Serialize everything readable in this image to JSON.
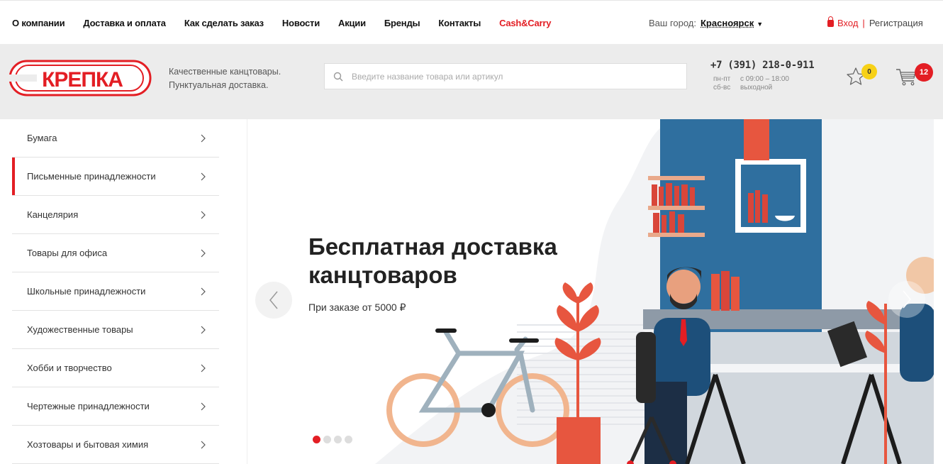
{
  "topnav": {
    "items": [
      "О компании",
      "Доставка и оплата",
      "Как сделать заказ",
      "Новости",
      "Акции",
      "Бренды",
      "Контакты",
      "Cash&Carry"
    ],
    "city_label": "Ваш город:",
    "city_value": "Красноярск",
    "login": "Вход",
    "separator": "|",
    "register": "Регистрация"
  },
  "header": {
    "logo_text": "КРЕПКА",
    "tagline_line1": "Качественные канцтовары.",
    "tagline_line2": "Пунктуальная доставка.",
    "search_placeholder": "Введите название товара или артикул",
    "phone": "+7 (391) 218-0-911",
    "hours": [
      {
        "days": "пн-пт",
        "time": "с 09:00 – 18:00"
      },
      {
        "days": "сб-вс",
        "time": "выходной"
      }
    ],
    "favorites_count": "0",
    "cart_count": "12"
  },
  "sidebar": {
    "items": [
      {
        "label": "Бумага",
        "active": false
      },
      {
        "label": "Письменные принадлежности",
        "active": true
      },
      {
        "label": "Канцелярия",
        "active": false
      },
      {
        "label": "Товары для офиса",
        "active": false
      },
      {
        "label": "Школьные принадлежности",
        "active": false
      },
      {
        "label": "Художественные товары",
        "active": false
      },
      {
        "label": "Хобби и творчество",
        "active": false
      },
      {
        "label": "Чертежные принадлежности",
        "active": false
      },
      {
        "label": "Хозтовары и бытовая химия",
        "active": false
      }
    ]
  },
  "banner": {
    "headline_line1": "Бесплатная доставка",
    "headline_line2": "канцтоваров",
    "subline": "При заказе от 5000 ₽",
    "slides_total": 4,
    "active_slide": 1
  },
  "colors": {
    "brand_red": "#e31e24",
    "badge_yellow": "#f7d117",
    "header_gray": "#ececec",
    "banner_blue": "#2f6f9f"
  },
  "icons": [
    "lock-icon",
    "caret-down-icon",
    "search-icon",
    "star-icon",
    "cart-icon",
    "chevron-right-icon",
    "chevron-left-icon"
  ]
}
